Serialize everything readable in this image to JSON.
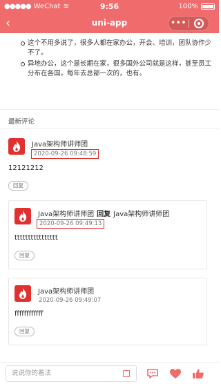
{
  "status_bar": {
    "carrier": "WeChat",
    "time": "9:56",
    "battery": "100%"
  },
  "nav": {
    "title": "uni-app",
    "more_glyph": "•••",
    "back_glyph": "‹"
  },
  "article": {
    "bullets": [
      "这个不用多说了，很多人都在家办公，开会、培训，团队协作少不了。",
      "异地办公，这个是长期在家，很多国外公司就是这样，甚至员工分布在各国，每年去总部一次的，也有。"
    ]
  },
  "comments": {
    "section_label": "最新评论",
    "reply_label": "回复",
    "items": [
      {
        "author": "Java架构师讲师团",
        "date": "2020-09-26 09:48:59",
        "text": "12121212"
      }
    ],
    "replies": [
      {
        "author": "Java架构师讲师团",
        "reply_word": "回复",
        "reply_to": "Java架构师讲师团",
        "date": "2020-09-26 09:49:13",
        "text": "tttttttttttttttt"
      },
      {
        "author": "Java架构师讲师团",
        "date": "2020-09-26 09:49:07",
        "text": "ffffffffffff"
      }
    ]
  },
  "bottom": {
    "placeholder": "说说你的看法"
  },
  "colors": {
    "brand": "#f06b6b",
    "avatar": "#e0302f",
    "highlight_box": "#e03030"
  },
  "icons": [
    "back-icon",
    "more-icon",
    "close-target-icon",
    "edit-icon",
    "comment-icon",
    "heart-icon",
    "thumbs-up-icon"
  ]
}
